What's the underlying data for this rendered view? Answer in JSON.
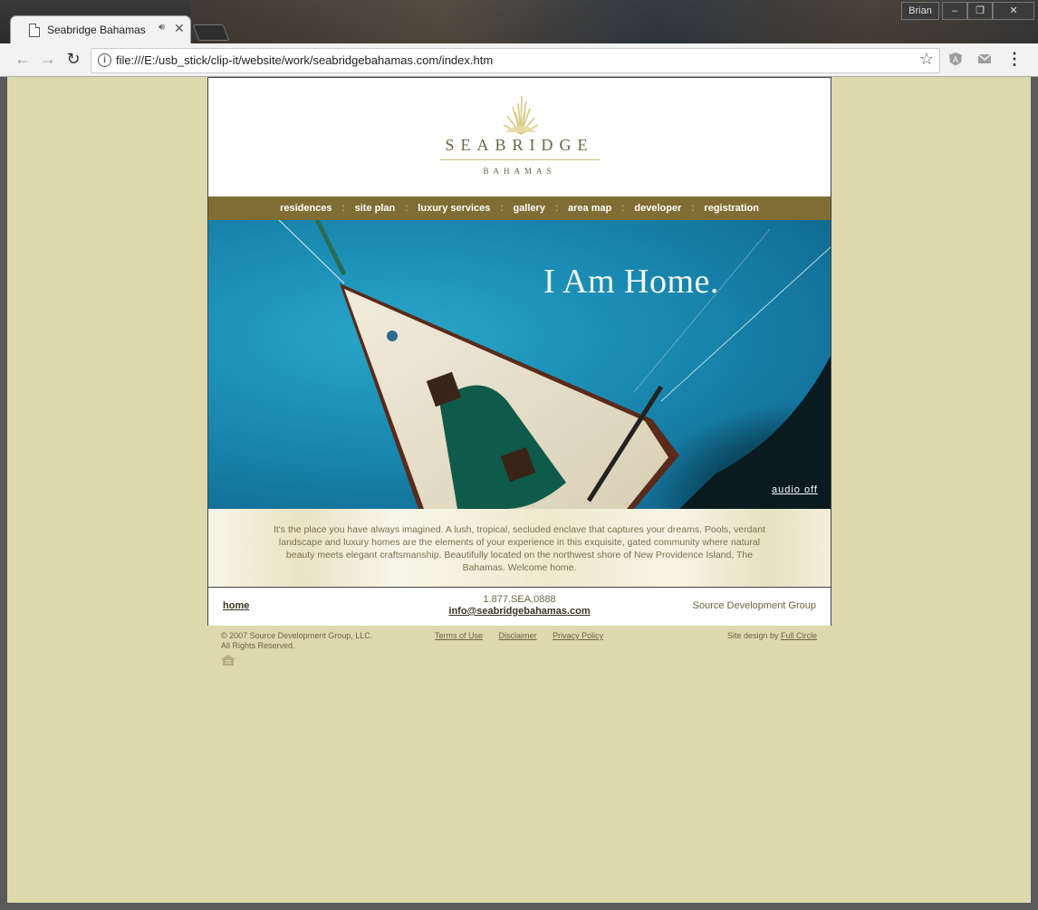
{
  "browser": {
    "tab_title": "Seabridge Bahamas",
    "url": "file:///E:/usb_stick/clip-it/website/work/seabridgebahamas.com/index.htm",
    "profile_name": "Brian"
  },
  "site": {
    "logo": {
      "name": "SEABRIDGE",
      "sub": "BAHAMAS"
    },
    "nav": [
      "residences",
      "site plan",
      "luxury services",
      "gallery",
      "area map",
      "developer",
      "registration"
    ],
    "nav_separator": ":",
    "hero": {
      "headline": "I Am Home.",
      "audio_label": "audio off"
    },
    "intro": "It's the place you have always imagined. A lush, tropical, secluded enclave that captures your dreams. Pools, verdant landscape and luxury homes are the elements of your experience in this exquisite, gated community where natural beauty meets elegant craftsmanship. Beautifully located on the northwest shore of New Providence Island, The Bahamas. Welcome home.",
    "footer": {
      "home_label": "home",
      "phone": "1.877.SEA.0888",
      "email": "info@seabridgebahamas.com",
      "company": "Source Development Group"
    },
    "legal": {
      "copyright_line1": "© 2007 Source Development Group, LLC.",
      "copyright_line2": "All Rights Reserved.",
      "links": [
        "Terms of Use",
        "Disclaimer",
        "Privacy Policy"
      ],
      "credit_prefix": "Site design by ",
      "credit_link": "Full Circle"
    }
  },
  "colors": {
    "page_bg": "#ded8ae",
    "nav_bg": "#7f6d34",
    "text_brown": "#6b6342"
  }
}
